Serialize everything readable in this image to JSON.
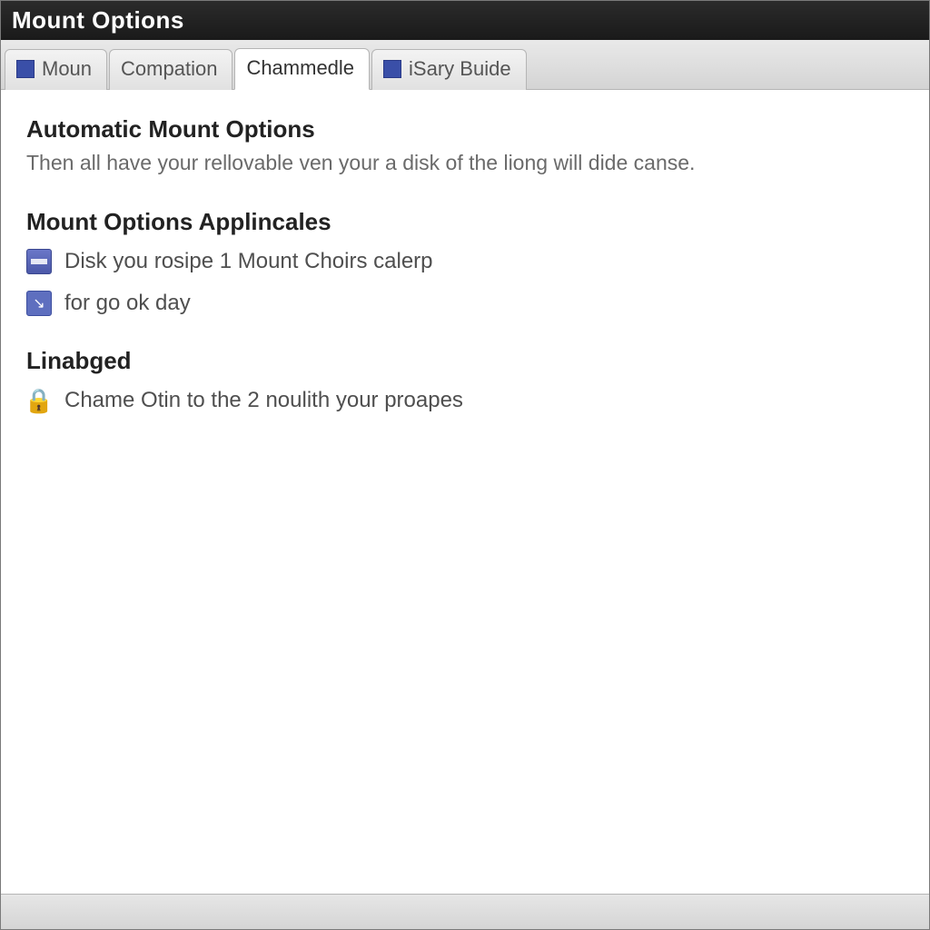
{
  "window": {
    "title": "Mount Options"
  },
  "tabs": [
    {
      "label": "Moun",
      "hasIcon": true,
      "active": false
    },
    {
      "label": "Compation",
      "hasIcon": false,
      "active": false
    },
    {
      "label": "Chammedle",
      "hasIcon": false,
      "active": true
    },
    {
      "label": "iSary Buide",
      "hasIcon": true,
      "active": false
    }
  ],
  "sections": {
    "auto": {
      "title": "Automatic Mount Options",
      "desc": "Then all have your rellovable ven your a disk of the liong will dide canse."
    },
    "appl": {
      "title": "Mount Options Applincales",
      "items": [
        {
          "icon": "disk",
          "label": "Disk you rosipe 1 Mount Choirs calerp"
        },
        {
          "icon": "page",
          "label": "for go ok day"
        }
      ]
    },
    "linabged": {
      "title": "Linabged",
      "items": [
        {
          "icon": "lock",
          "label": "Chame Otin to the 2 noulith your proapes"
        }
      ]
    }
  }
}
